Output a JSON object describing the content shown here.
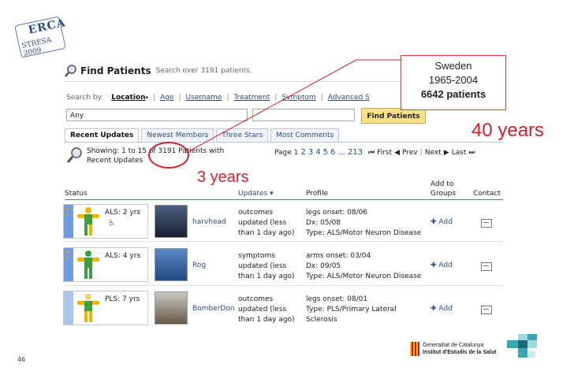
{
  "corner_logo": {
    "line1": "ERCA",
    "line2": "STRESA 2009"
  },
  "find_patients": {
    "title": "Find Patients",
    "subtitle": "Search over 3191 patients.",
    "search_by_label": "Search by:",
    "search_options": [
      "Location",
      "Age",
      "Username",
      "Treatment",
      "Symptom",
      "Advanced S"
    ],
    "selected_option": "Location",
    "select_value": "Any",
    "find_button": "Find Patients"
  },
  "tabs": [
    "Recent Updates",
    "Newest Members",
    "Three Stars",
    "Most Comments"
  ],
  "active_tab": "Recent Updates",
  "results": {
    "showing_text": "Showing: 1 to 15 of 3191 Patients with Recent Updates",
    "page_label": "Page",
    "pages": [
      "1",
      "2",
      "3",
      "4",
      "5",
      "6",
      "...",
      "213"
    ],
    "first": "First",
    "prev": "Prev",
    "next": "Next",
    "last": "Last"
  },
  "table": {
    "headers": [
      "Status",
      "Updates ▾",
      "Profile",
      "Add to Groups",
      "Contact"
    ],
    "rows": [
      {
        "status": "ALS: 2 yrs",
        "stripe_color": "#6f9be0",
        "username": "harvhead",
        "update": "outcomes updated (less than 1 day ago)",
        "profile_lines": [
          "legs onset: 08/06",
          "Dx: 05/08",
          "Type: ALS/Motor Neuron Disease"
        ],
        "add": "Add",
        "figure_colors": [
          "#f0b400",
          "#f0b400",
          "#3ca03c",
          "#3ca03c",
          "#f0b400"
        ]
      },
      {
        "status": "ALS: 4 yrs",
        "stripe_color": "#6f9be0",
        "username": "Rog",
        "update": "symptoms updated (less than 1 day ago)",
        "profile_lines": [
          "arms onset: 03/04",
          "Dx: 09/05",
          "Type: ALS/Motor Neuron Disease"
        ],
        "add": "Add",
        "figure_colors": [
          "#3ca03c",
          "#f0b400",
          "#3ca03c",
          "#3ca03c",
          "#3ca03c"
        ]
      },
      {
        "status": "PLS: 7 yrs",
        "stripe_color": "#aac4ec",
        "username": "BomberDon",
        "update": "outcomes updated (less than 1 day ago)",
        "profile_lines": [
          "legs onset: 08/01",
          "Type: PLS/Primary Lateral",
          "Sclerosis"
        ],
        "add": "Add",
        "figure_colors": [
          "#f0d060",
          "#f0b400",
          "#3ca03c",
          "#f0b400",
          "#f0b400"
        ]
      }
    ]
  },
  "annotations": {
    "callout_line1": "Sweden",
    "callout_line2": "1965-2004",
    "callout_line3": "6642 patients",
    "years40": "40 years",
    "years3": "3 years"
  },
  "slide_number": "46",
  "footer_logo": {
    "line1": "Generalitat de Catalunya",
    "line2": "Institut d'Estudis de la Salut"
  },
  "colors": {
    "accent_red": "#d4202a",
    "link_blue": "#2a4c8c",
    "button_yellow": "#fbe08a"
  }
}
